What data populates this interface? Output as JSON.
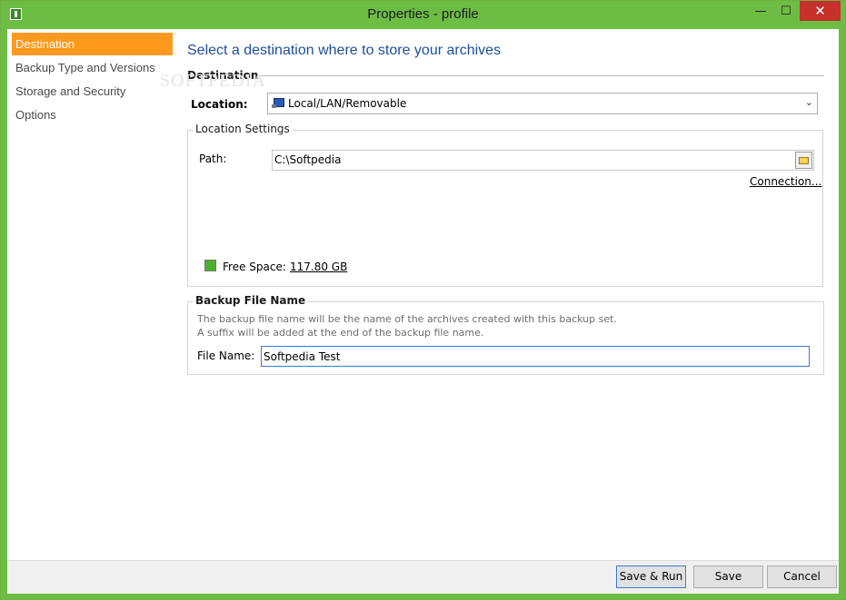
{
  "window": {
    "title": "Properties - profile",
    "controls": {
      "minimize": "—",
      "maximize": "☐",
      "close": "✕"
    }
  },
  "sidebar": {
    "items": [
      {
        "label": "Destination",
        "active": true
      },
      {
        "label": "Backup Type and Versions",
        "active": false
      },
      {
        "label": "Storage and Security",
        "active": false
      },
      {
        "label": "Options",
        "active": false
      }
    ]
  },
  "main": {
    "heading": "Select a destination where to store your archives",
    "destination_title": "Destination",
    "location": {
      "label": "Location:",
      "value": "Local/LAN/Removable",
      "icon": "computer-icon"
    },
    "location_settings": {
      "legend": "Location Settings",
      "path_label": "Path:",
      "path_value": "C:\\Softpedia",
      "connection_link": "Connection...",
      "free_space_label": "Free Space:",
      "free_space_value": "117.80 GB",
      "free_space_color": "#4caf2e"
    },
    "backup_file_name": {
      "legend": "Backup File Name",
      "desc_line1": "The backup file name will be the name of the archives created with this backup set.",
      "desc_line2": "A suffix will be added at the end of the backup file name.",
      "file_name_label": "File Name:",
      "file_name_value": "Softpedia Test"
    }
  },
  "footer": {
    "save_run": "Save & Run",
    "save": "Save",
    "cancel": "Cancel"
  },
  "watermark": "SOFTPEDIA",
  "colors": {
    "accent_title": "#6dbd45",
    "active_nav": "#ff9a1f",
    "heading": "#1f4e9a",
    "close_button": "#c7302b"
  }
}
